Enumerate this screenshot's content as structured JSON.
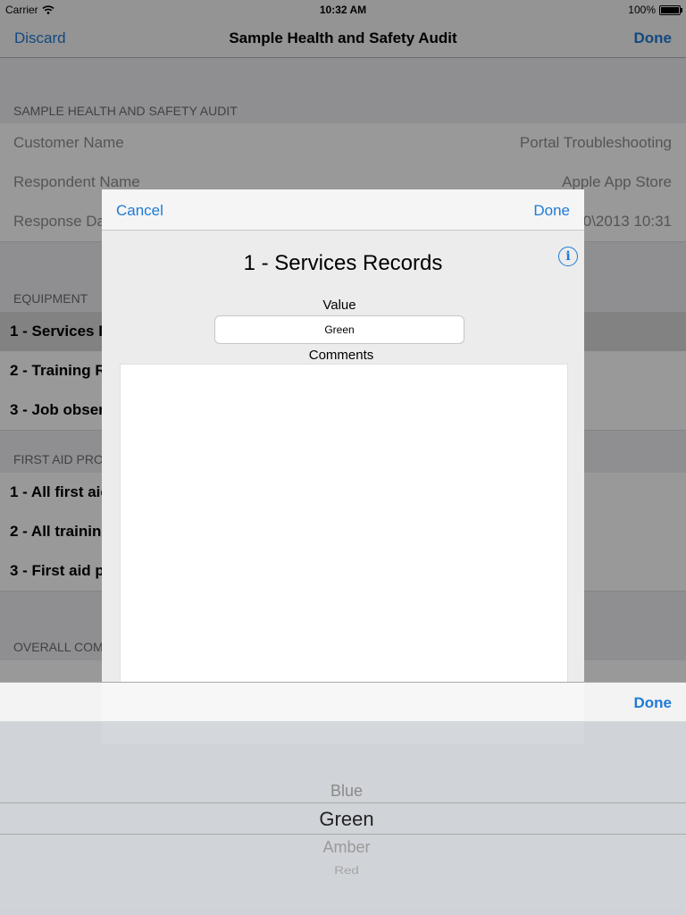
{
  "status_bar": {
    "carrier": "Carrier",
    "time": "10:32 AM",
    "battery": "100%"
  },
  "nav": {
    "left": "Discard",
    "title": "Sample Health and Safety Audit",
    "right": "Done"
  },
  "form": {
    "section_title": "SAMPLE HEALTH AND SAFETY AUDIT",
    "rows": [
      {
        "label": "Customer Name",
        "value": "Portal Troubleshooting"
      },
      {
        "label": "Respondent Name",
        "value": "Apple App Store"
      },
      {
        "label": "Response Da",
        "value": "0\\2013 10:31"
      }
    ],
    "sections": [
      {
        "title": "EQUIPMENT",
        "items": [
          "1 - Services R",
          "2 - Training R",
          "3 - Job obser"
        ]
      },
      {
        "title": "FIRST AID PRO",
        "items": [
          "1 - All first aic",
          "2 - All training",
          "3 - First aid p"
        ]
      },
      {
        "title": "OVERALL COM"
      }
    ]
  },
  "modal": {
    "cancel": "Cancel",
    "done": "Done",
    "title": "1 - Services Records",
    "info_icon": "info-icon",
    "value_label": "Value",
    "value": "Green",
    "comments_label": "Comments",
    "comments": ""
  },
  "picker": {
    "done": "Done",
    "options": [
      "Blue",
      "Green",
      "Amber",
      "Red"
    ],
    "selected": "Green"
  },
  "colors": {
    "accent": "#1f7bd6"
  }
}
